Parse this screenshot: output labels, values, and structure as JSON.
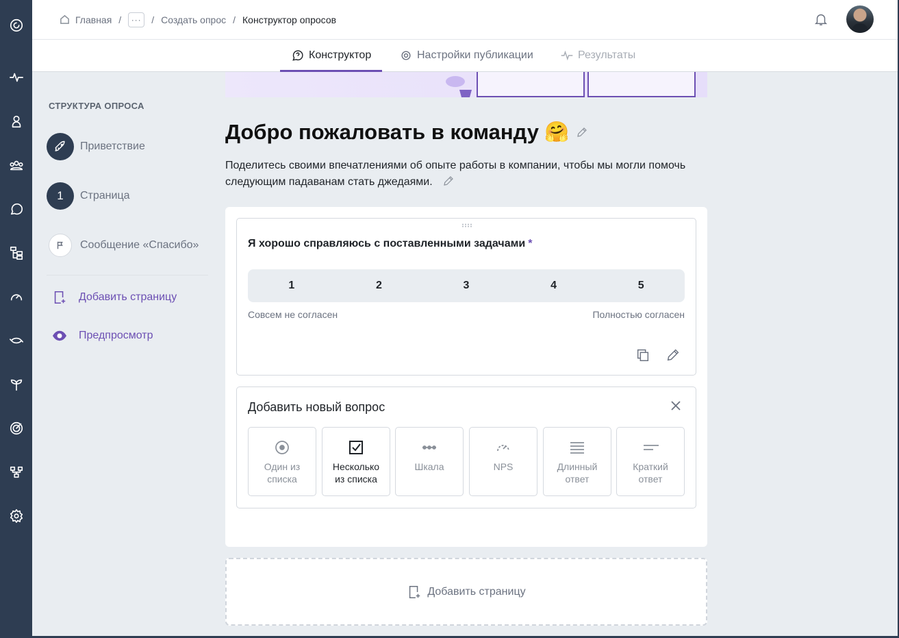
{
  "breadcrumb": {
    "home": "Главная",
    "more": "···",
    "create": "Создать опрос",
    "current": "Конструктор опросов"
  },
  "header": {
    "bell_icon": "bell-icon",
    "avatar": "user-avatar"
  },
  "tabs": [
    {
      "label": "Конструктор",
      "icon": "question-bubble-icon",
      "state": "active"
    },
    {
      "label": "Настройки публикации",
      "icon": "gear-icon",
      "state": "normal"
    },
    {
      "label": "Результаты",
      "icon": "pulse-icon",
      "state": "disabled"
    }
  ],
  "sidebar": {
    "title": "СТРУКТУРА ОПРОСА",
    "steps": [
      {
        "label": "Приветствие",
        "badge": "",
        "icon": "rocket-icon"
      },
      {
        "label": "Страница",
        "badge": "1",
        "icon": ""
      },
      {
        "label": "Сообщение «Спасибо»",
        "badge": "",
        "icon": "flag-icon"
      }
    ],
    "add_page": "Добавить страницу",
    "preview": "Предпросмотр"
  },
  "page": {
    "title": "Добро пожаловать в команду",
    "title_emoji": "🤗",
    "description": "Поделитесь своими впечатлениями об опыте работы в компании, чтобы мы могли помочь следующим падаванам стать джедаями."
  },
  "question": {
    "text": "Я хорошо справляюсь с поставленными задачами",
    "required_mark": "*",
    "options": [
      "1",
      "2",
      "3",
      "4",
      "5"
    ],
    "label_min": "Совсем не согласен",
    "label_max": "Полностью согласен"
  },
  "add_question": {
    "title": "Добавить новый вопрос",
    "types": [
      {
        "label": "Один из\nсписка",
        "icon": "radio-icon",
        "selected": false
      },
      {
        "label": "Несколько\nиз списка",
        "icon": "checkbox-icon",
        "selected": true
      },
      {
        "label": "Шкала",
        "icon": "scale-icon",
        "selected": false
      },
      {
        "label": "NPS",
        "icon": "gauge-icon",
        "selected": false
      },
      {
        "label": "Длинный\nответ",
        "icon": "long-text-icon",
        "selected": false
      },
      {
        "label": "Краткий\nответ",
        "icon": "short-text-icon",
        "selected": false
      }
    ]
  },
  "add_page_bottom": "Добавить страницу",
  "colors": {
    "accent": "#6c4fb3",
    "rail": "#2e3d52",
    "background": "#e9edf1"
  }
}
